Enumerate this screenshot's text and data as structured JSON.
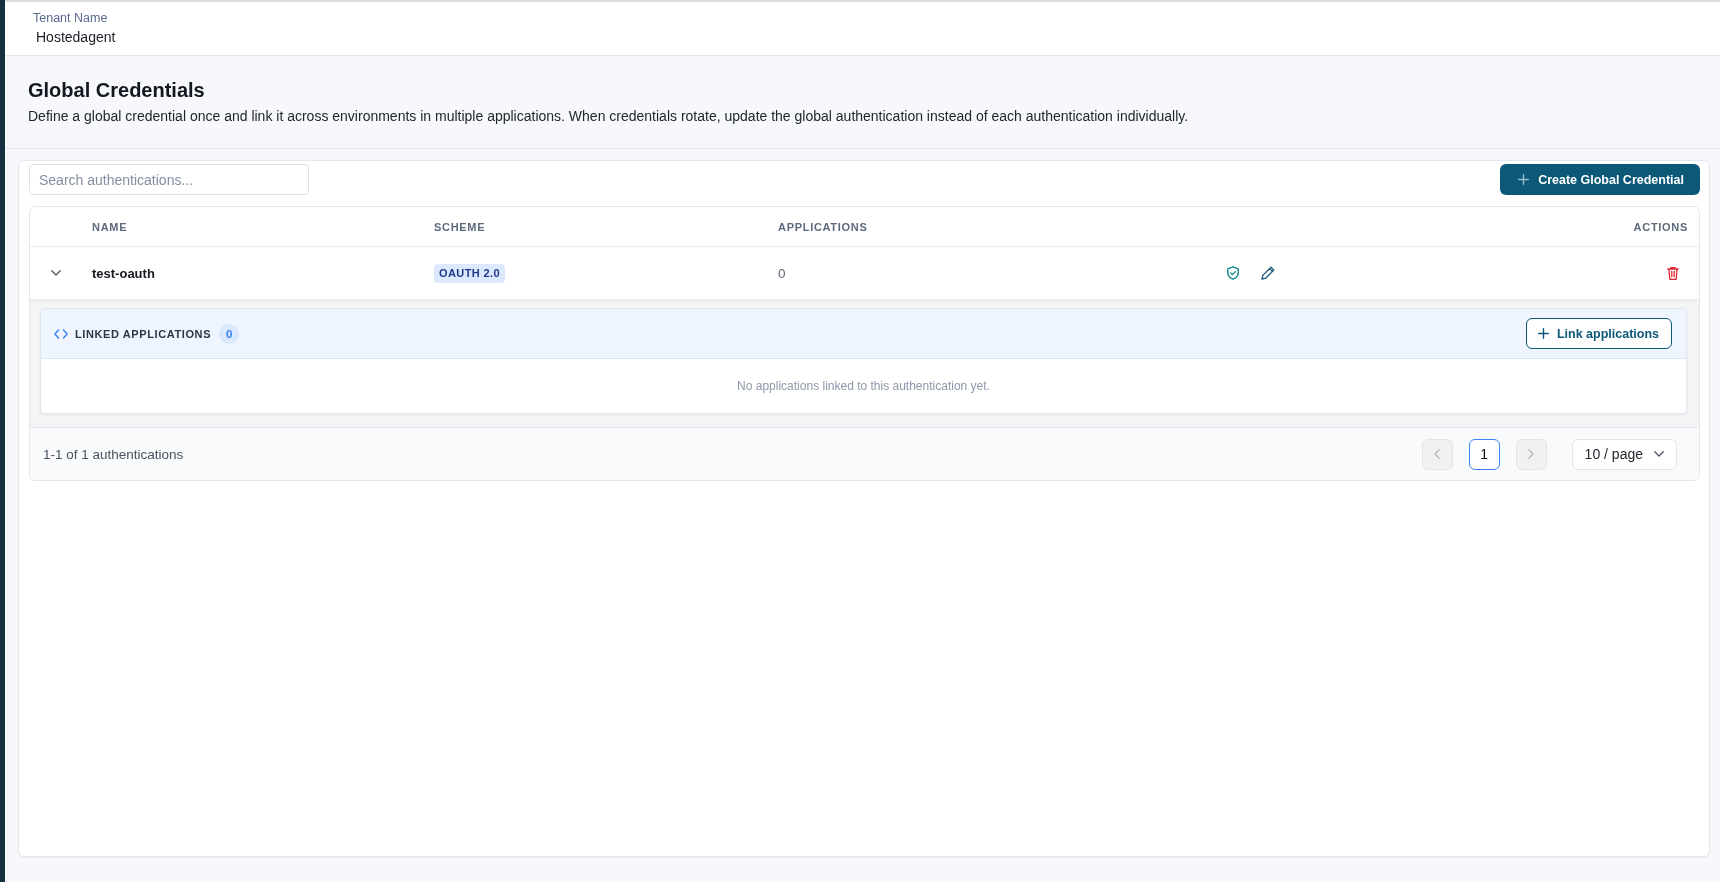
{
  "tenant": {
    "label": "Tenant Name",
    "name": "Hostedagent"
  },
  "header": {
    "title": "Global Credentials",
    "description": "Define a global credential once and link it across environments in multiple applications. When credentials rotate, update the global authentication instead of each authentication individually."
  },
  "toolbar": {
    "search": {
      "placeholder": "Search authentications..."
    },
    "create_button": "Create Global Credential"
  },
  "table": {
    "columns": [
      "NAME",
      "SCHEME",
      "APPLICATIONS",
      "ACTIONS"
    ],
    "rows": [
      {
        "name": "test-oauth",
        "scheme": "OAUTH 2.0",
        "applications": "0",
        "expanded": true,
        "linked": {
          "title": "LINKED APPLICATIONS",
          "count": "0",
          "button": "Link applications",
          "empty_text": "No applications linked to this authentication yet."
        }
      }
    ]
  },
  "pagination": {
    "summary": "1-1 of 1 authentications",
    "prev": {
      "disabled": true
    },
    "pages": [
      {
        "label": "1",
        "selected": true
      }
    ],
    "next": {
      "disabled": true
    },
    "page_size": "10 / page"
  }
}
